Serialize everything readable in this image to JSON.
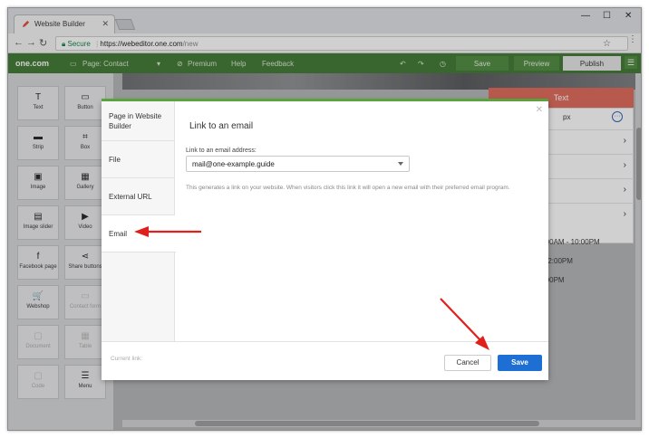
{
  "browser": {
    "tab_title": "Website Builder",
    "url_secure_label": "Secure",
    "url_host": "https://webeditor.one.com",
    "url_path": "/new"
  },
  "app_toolbar": {
    "logo": "one.com",
    "page_label": "Page: Contact",
    "premium": "Premium",
    "help": "Help",
    "feedback": "Feedback",
    "save": "Save",
    "preview": "Preview",
    "publish": "Publish"
  },
  "tools": [
    {
      "label": "Text",
      "icon": "text-icon",
      "glyph": "T",
      "disabled": false
    },
    {
      "label": "Button",
      "icon": "button-icon",
      "glyph": "▭",
      "disabled": false
    },
    {
      "label": "Strip",
      "icon": "strip-icon",
      "glyph": "▬",
      "disabled": false
    },
    {
      "label": "Box",
      "icon": "box-icon",
      "glyph": "⌗",
      "disabled": false
    },
    {
      "label": "Image",
      "icon": "image-icon",
      "glyph": "▣",
      "disabled": false
    },
    {
      "label": "Gallery",
      "icon": "gallery-icon",
      "glyph": "▦",
      "disabled": false
    },
    {
      "label": "Image slider",
      "icon": "image-slider-icon",
      "glyph": "▤",
      "disabled": false
    },
    {
      "label": "Video",
      "icon": "video-icon",
      "glyph": "▶",
      "disabled": false
    },
    {
      "label": "Facebook page",
      "icon": "facebook-icon",
      "glyph": "f",
      "disabled": false
    },
    {
      "label": "Share buttons",
      "icon": "share-icon",
      "glyph": "⋖",
      "disabled": false
    },
    {
      "label": "Webshop",
      "icon": "cart-icon",
      "glyph": "🛒",
      "disabled": false
    },
    {
      "label": "Contact form",
      "icon": "contact-form-icon",
      "glyph": "▭",
      "disabled": true
    },
    {
      "label": "Document",
      "icon": "document-icon",
      "glyph": "▢",
      "disabled": true
    },
    {
      "label": "Table",
      "icon": "table-icon",
      "glyph": "▦",
      "disabled": true
    },
    {
      "label": "Code",
      "icon": "code-icon",
      "glyph": "▢",
      "disabled": true
    },
    {
      "label": "Menu",
      "icon": "menu-icon",
      "glyph": "☰",
      "disabled": false
    }
  ],
  "text_panel": {
    "title": "Text",
    "px_value": "5",
    "px_unit": "px",
    "rows": [
      "",
      "dow",
      "g",
      ""
    ],
    "hours": [
      "1:00AM - 10:00PM",
      "- 12:00PM",
      "2:00PM"
    ]
  },
  "dialog": {
    "nav": [
      "Page in Website Builder",
      "File",
      "External URL",
      "Email"
    ],
    "active_nav": "Email",
    "title": "Link to an email",
    "field_label": "Link to an email address:",
    "field_value": "mail@one-example.guide",
    "help_text": "This generates a link on your website. When visitors click this link it will open a new email with their preferred email program.",
    "current_link_label": "Current link:",
    "cancel": "Cancel",
    "save": "Save"
  },
  "colors": {
    "brand_green": "#3e7630",
    "accent_red": "#e06759",
    "primary_blue": "#1e6fd4",
    "annotation_red": "#e0201c"
  }
}
